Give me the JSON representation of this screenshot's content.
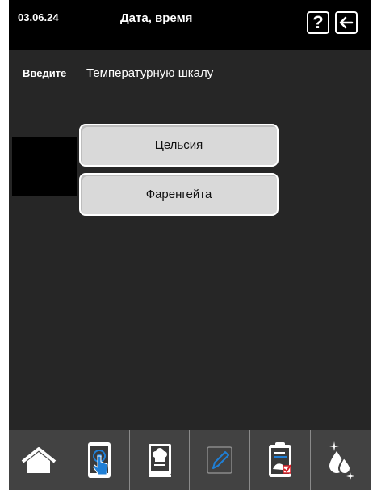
{
  "header": {
    "date": "03.06.24",
    "title": "Дата, время",
    "help_glyph": "?",
    "help_icon": "question-icon",
    "back_icon": "arrow-left-icon"
  },
  "prompt": {
    "label": "Введите",
    "text": "Температурную шкалу"
  },
  "options": [
    {
      "label": "Цельсия"
    },
    {
      "label": "Фаренгейта"
    }
  ],
  "bottom_nav": [
    {
      "icon": "home-icon"
    },
    {
      "icon": "touch-tablet-icon"
    },
    {
      "icon": "recipe-book-icon"
    },
    {
      "icon": "pencil-edit-icon"
    },
    {
      "icon": "checklist-clipboard-icon"
    },
    {
      "icon": "cleaning-drops-icon"
    }
  ],
  "colors": {
    "header_bg": "#000000",
    "screen_bg": "#262626",
    "button_bg": "#d9d9d9",
    "nav_bg": "#424242",
    "accent_blue": "#1f7fd6",
    "accent_red": "#d42027"
  }
}
